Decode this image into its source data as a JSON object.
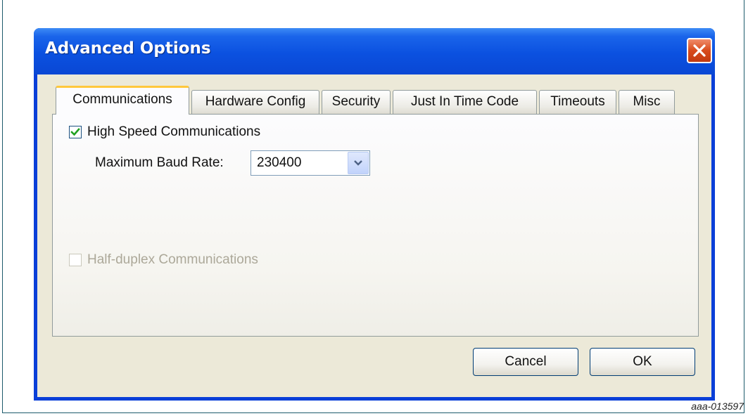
{
  "window": {
    "title": "Advanced Options"
  },
  "tabs": [
    {
      "label": "Communications",
      "active": true
    },
    {
      "label": "Hardware Config",
      "active": false
    },
    {
      "label": "Security",
      "active": false
    },
    {
      "label": "Just In Time Code",
      "active": false
    },
    {
      "label": "Timeouts",
      "active": false
    },
    {
      "label": "Misc",
      "active": false
    }
  ],
  "communications": {
    "high_speed": {
      "label": "High Speed Communications",
      "checked": true
    },
    "baud_rate": {
      "label": "Maximum Baud Rate:",
      "value": "230400"
    },
    "half_duplex": {
      "label": "Half-duplex Communications",
      "checked": false,
      "enabled": false
    }
  },
  "buttons": {
    "cancel": "Cancel",
    "ok": "OK"
  },
  "caption": "aaa-013597",
  "icons": {
    "close": "close-icon",
    "check": "checkmark-icon",
    "dropdown": "chevron-down-icon"
  },
  "colors": {
    "titlebar": "#0a47d4",
    "close": "#d84b1c",
    "tab_highlight": "#ffc83c",
    "check": "#21a121"
  }
}
